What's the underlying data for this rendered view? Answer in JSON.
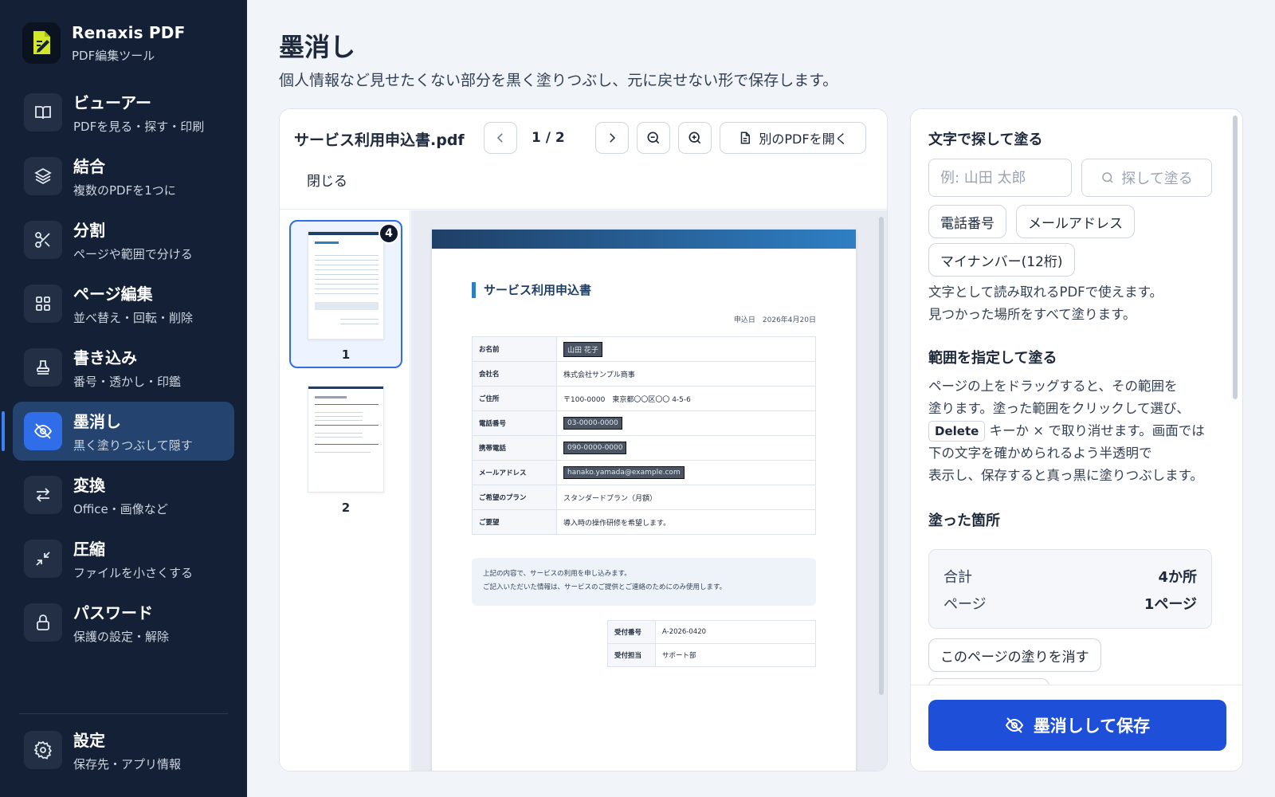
{
  "app": {
    "name": "Renaxis PDF",
    "subtitle": "PDF編集ツール"
  },
  "nav": [
    {
      "icon": "book-open-icon",
      "label": "ビューアー",
      "sub": "PDFを見る・探す・印刷",
      "active": false
    },
    {
      "icon": "layers-icon",
      "label": "結合",
      "sub": "複数のPDFを1つに",
      "active": false
    },
    {
      "icon": "scissors-icon",
      "label": "分割",
      "sub": "ページや範囲で分ける",
      "active": false
    },
    {
      "icon": "grid-icon",
      "label": "ページ編集",
      "sub": "並べ替え・回転・削除",
      "active": false
    },
    {
      "icon": "stamp-icon",
      "label": "書き込み",
      "sub": "番号・透かし・印鑑",
      "active": false
    },
    {
      "icon": "eye-off-icon",
      "label": "墨消し",
      "sub": "黒く塗りつぶして隠す",
      "active": true
    },
    {
      "icon": "swap-arrows-icon",
      "label": "変換",
      "sub": "Office・画像など",
      "active": false
    },
    {
      "icon": "compress-icon",
      "label": "圧縮",
      "sub": "ファイルを小さくする",
      "active": false
    },
    {
      "icon": "lock-icon",
      "label": "パスワード",
      "sub": "保護の設定・解除",
      "active": false
    }
  ],
  "settings": {
    "label": "設定",
    "sub": "保存先・アプリ情報"
  },
  "page": {
    "title": "墨消し",
    "description": "個人情報など見せたくない部分を黒く塗りつぶし、元に戻せない形で保存します。"
  },
  "viewer": {
    "file_name": "サービス利用申込書.pdf",
    "page_indicator": "1 / 2",
    "open_other_label": "別のPDFを開く",
    "close_label": "閉じる",
    "thumbnails": [
      {
        "number": "1",
        "badge": "4",
        "selected": true
      },
      {
        "number": "2",
        "badge": "",
        "selected": false
      }
    ]
  },
  "document": {
    "title": "サービス利用申込書",
    "date": "申込日　2026年4月20日",
    "rows": [
      {
        "key": "お名前",
        "value": "山田 花子",
        "redacted": true
      },
      {
        "key": "会社名",
        "value": "株式会社サンプル商事",
        "redacted": false
      },
      {
        "key": "ご住所",
        "value": "〒100-0000　東京都〇〇区〇〇 4-5-6",
        "redacted": false
      },
      {
        "key": "電話番号",
        "value": "03-0000-0000",
        "redacted": true
      },
      {
        "key": "携帯電話",
        "value": "090-0000-0000",
        "redacted": true
      },
      {
        "key": "メールアドレス",
        "value": "hanako.yamada@example.com",
        "redacted": true
      },
      {
        "key": "ご希望のプラン",
        "value": "スタンダードプラン（月額）",
        "redacted": false
      },
      {
        "key": "ご要望",
        "value": "導入時の操作研修を希望します。",
        "redacted": false
      }
    ],
    "note_line1": "上記の内容で、サービスの利用を申し込みます。",
    "note_line2": "ご記入いただいた情報は、サービスのご提供とご連絡のためにのみ使用します。",
    "receipt": [
      {
        "key": "受付番号",
        "value": "A-2026-0420"
      },
      {
        "key": "受付担当",
        "value": "サポート部"
      }
    ]
  },
  "panel": {
    "search_section_title": "文字で探して塗る",
    "search_placeholder": "例: 山田 太郎",
    "search_button": "探して塗る",
    "chips": [
      "電話番号",
      "メールアドレス",
      "マイナンバー(12桁)"
    ],
    "search_help_1": "文字として読み取れるPDFで使えます。",
    "search_help_2": "見つかった場所をすべて塗ります。",
    "range_section_title": "範囲を指定して塗る",
    "range_help_1": "ページの上をドラッグすると、その範囲を",
    "range_help_2": "塗ります。塗った範囲をクリックして選び、",
    "range_help_kbd": "Delete",
    "range_help_3": "キーか × で取り消せます。画面では",
    "range_help_4": "下の文字を確かめられるよう半透明で",
    "range_help_5": "表示し、保存すると真っ黒に塗りつぶします。",
    "painted_section_title": "塗った箇所",
    "total_label": "合計",
    "total_value": "4か所",
    "pages_label": "ページ",
    "pages_value": "1ページ",
    "clear_page_button": "このページの塗りを消す",
    "save_button": "墨消しして保存"
  },
  "colors": {
    "sidebar_bg": "#142035",
    "active_nav": "#24436f",
    "accent": "#2f6ee8",
    "primary_button": "#1d4fd8",
    "redaction": "#4b5563"
  }
}
